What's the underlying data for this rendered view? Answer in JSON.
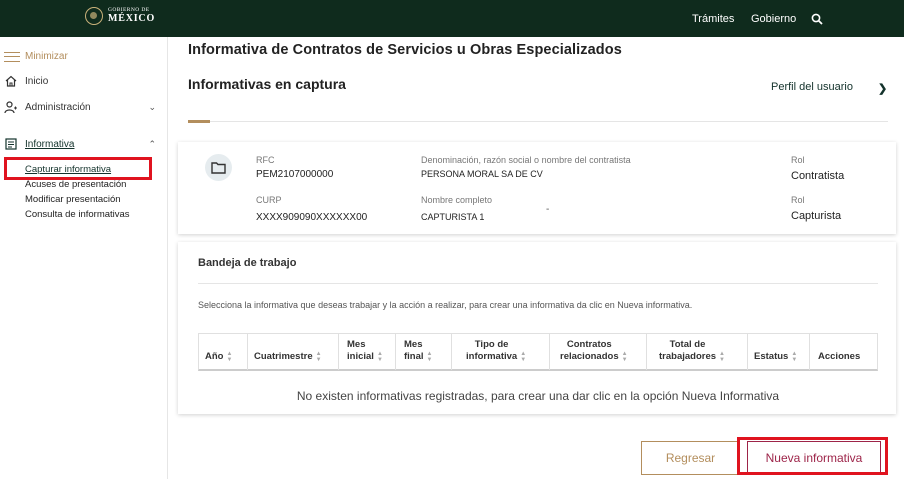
{
  "topbar": {
    "logo_small": "GOBIERNO DE",
    "logo_big": "MÉXICO",
    "nav": [
      "Trámites",
      "Gobierno"
    ],
    "search_icon": "search-icon",
    "bg_color": "#0f2b1d"
  },
  "sidebar": {
    "minimizar": "Minimizar",
    "inicio": "Inicio",
    "administracion": "Administración",
    "informativa": "Informativa",
    "subitems": [
      "Capturar informativa",
      "Acuses de presentación",
      "Modificar presentación",
      "Consulta de informativas"
    ]
  },
  "main": {
    "title": "Informativa de Contratos de Servicios u Obras Especializados",
    "subtitle": "Informativas en captura",
    "perfil": "Perfil del usuario"
  },
  "info_card": {
    "rfc_label": "RFC",
    "rfc_value": "PEM2107000000",
    "curp_label": "CURP",
    "curp_value": "XXXX909090XXXXXX00",
    "denominacion_label": "Denominación, razón social o nombre del contratista",
    "denominacion_value": "PERSONA MORAL SA DE CV",
    "nombre_label": "Nombre completo",
    "nombre_value": "CAPTURISTA 1",
    "dash": "-",
    "rol1_label": "Rol",
    "rol1_value": "Contratista",
    "rol2_label": "Rol",
    "rol2_value": "Capturista"
  },
  "bandeja": {
    "title": "Bandeja de trabajo",
    "instruccion": "Selecciona la informativa que deseas trabajar y la acción a realizar, para crear una informativa da clic en Nueva informativa.",
    "columns": [
      {
        "l1": "",
        "l2": "Año"
      },
      {
        "l1": "",
        "l2": "Cuatrimestre"
      },
      {
        "l1": "Mes",
        "l2": "inicial"
      },
      {
        "l1": "Mes",
        "l2": "final"
      },
      {
        "l1": "Tipo de",
        "l2": "informativa"
      },
      {
        "l1": "Contratos",
        "l2": "relacionados"
      },
      {
        "l1": "Total de",
        "l2": "trabajadores"
      },
      {
        "l1": "",
        "l2": "Estatus"
      },
      {
        "l1": "",
        "l2": "Acciones"
      }
    ],
    "empty_message": "No existen informativas registradas, para crear una dar clic en la opción Nueva Informativa"
  },
  "buttons": {
    "regresar": "Regresar",
    "nueva": "Nueva informativa"
  },
  "colors": {
    "accent_gold": "#b38e5d",
    "accent_guinda": "#9d2449",
    "highlight_red": "#e0131f"
  }
}
